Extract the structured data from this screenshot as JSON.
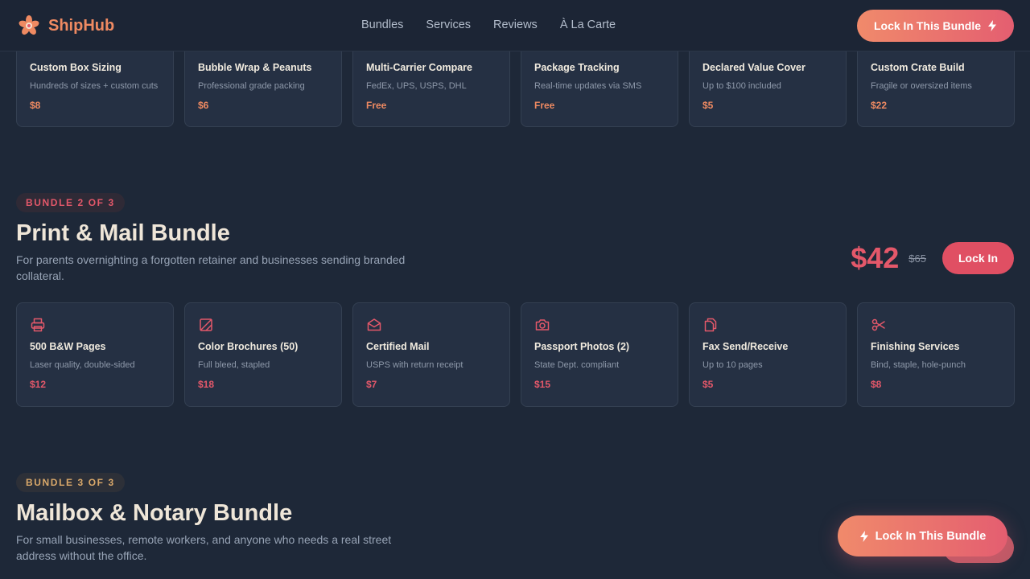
{
  "header": {
    "logo_text": "ShipHub",
    "nav": [
      "Bundles",
      "Services",
      "Reviews",
      "À La Carte"
    ],
    "cta_label": "Lock In This Bundle"
  },
  "bundle1_services": [
    {
      "title": "Custom Box Sizing",
      "subtitle": "Hundreds of sizes + custom cuts",
      "price": "$8"
    },
    {
      "title": "Bubble Wrap & Peanuts",
      "subtitle": "Professional grade packing",
      "price": "$6"
    },
    {
      "title": "Multi-Carrier Compare",
      "subtitle": "FedEx, UPS, USPS, DHL",
      "price": "Free"
    },
    {
      "title": "Package Tracking",
      "subtitle": "Real-time updates via SMS",
      "price": "Free"
    },
    {
      "title": "Declared Value Cover",
      "subtitle": "Up to $100 included",
      "price": "$5"
    },
    {
      "title": "Custom Crate Build",
      "subtitle": "Fragile or oversized items",
      "price": "$22"
    }
  ],
  "bundle2": {
    "badge": "BUNDLE 2 OF 3",
    "title": "Print & Mail Bundle",
    "description": "For parents overnighting a forgotten retainer and businesses sending branded collateral.",
    "price": "$42",
    "original_price": "$65",
    "cta_label": "Lock In",
    "services": [
      {
        "icon": "printer-icon",
        "title": "500 B&W Pages",
        "subtitle": "Laser quality, double-sided",
        "price": "$12"
      },
      {
        "icon": "brochure-icon",
        "title": "Color Brochures (50)",
        "subtitle": "Full bleed, stapled",
        "price": "$18"
      },
      {
        "icon": "envelope-icon",
        "title": "Certified Mail",
        "subtitle": "USPS with return receipt",
        "price": "$7"
      },
      {
        "icon": "camera-icon",
        "title": "Passport Photos (2)",
        "subtitle": "State Dept. compliant",
        "price": "$15"
      },
      {
        "icon": "copy-icon",
        "title": "Fax Send/Receive",
        "subtitle": "Up to 10 pages",
        "price": "$5"
      },
      {
        "icon": "scissors-icon",
        "title": "Finishing Services",
        "subtitle": "Bind, staple, hole-punch",
        "price": "$8"
      }
    ]
  },
  "bundle3": {
    "badge": "BUNDLE 3 OF 3",
    "title": "Mailbox & Notary Bundle",
    "description": "For small businesses, remote workers, and anyone who needs a real street address without the office."
  },
  "floating_cta": {
    "label": "Lock In This Bundle"
  },
  "colors": {
    "background": "#1e2838",
    "accent_orange": "#ef8a62",
    "accent_red": "#e4586a",
    "gold": "#d9a86a"
  }
}
